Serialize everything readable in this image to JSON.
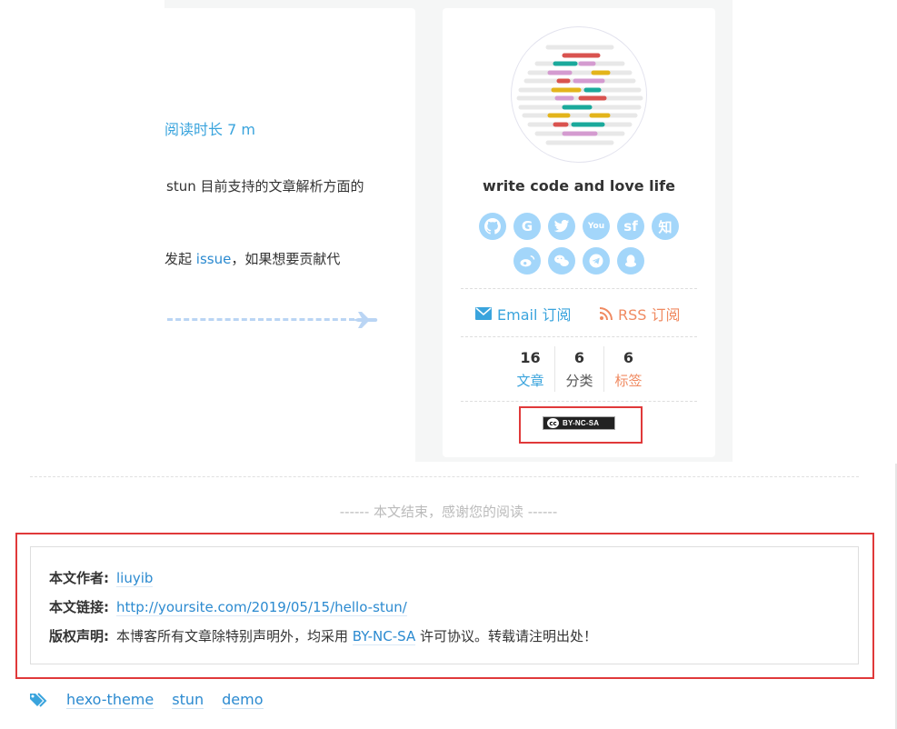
{
  "article": {
    "read_time": "阅读时长 7 m",
    "line1": "stun 目前支持的文章解析方面的",
    "line2_pre": "发起 ",
    "line2_link": "issue",
    "line2_post": "，如果想要贡献代"
  },
  "sidebar": {
    "motto": "write code and love life",
    "social_icons": [
      {
        "name": "github-icon",
        "glyph": ""
      },
      {
        "name": "google-icon",
        "glyph": "G"
      },
      {
        "name": "twitter-icon",
        "glyph": ""
      },
      {
        "name": "youtube-icon",
        "glyph": "You"
      },
      {
        "name": "segmentfault-icon",
        "glyph": "sf"
      },
      {
        "name": "zhihu-icon",
        "glyph": "知"
      },
      {
        "name": "weibo-icon",
        "glyph": ""
      },
      {
        "name": "wechat-icon",
        "glyph": ""
      },
      {
        "name": "telegram-icon",
        "glyph": ""
      },
      {
        "name": "qq-icon",
        "glyph": ""
      }
    ],
    "email_label": "Email 订阅",
    "rss_label": "RSS 订阅",
    "stats": [
      {
        "num": "16",
        "label": "文章",
        "color": "#3aa4dd"
      },
      {
        "num": "6",
        "label": "分类",
        "color": "#555555"
      },
      {
        "num": "6",
        "label": "标签",
        "color": "#f08a61"
      }
    ],
    "license_badge": "BY-NC-SA",
    "license_cc": "cc"
  },
  "post_end": {
    "text": "------ 本文结束，感谢您的阅读 ------"
  },
  "copyright": {
    "author_key": "本文作者:",
    "author_val": "liuyib",
    "link_key": "本文链接:",
    "link_val": "http://yoursite.com/2019/05/15/hello-stun/",
    "license_key": "版权声明:",
    "license_pre": "本博客所有文章除特别声明外，均采用 ",
    "license_link": "BY-NC-SA",
    "license_post": " 许可协议。转载请注明出处！"
  },
  "tags": [
    "hexo-theme",
    "stun",
    "demo"
  ],
  "colors": {
    "accent": "#2b8ad0",
    "social_bg": "#a3d6fa",
    "highlight": "#e0393a",
    "rss": "#f08a61"
  }
}
